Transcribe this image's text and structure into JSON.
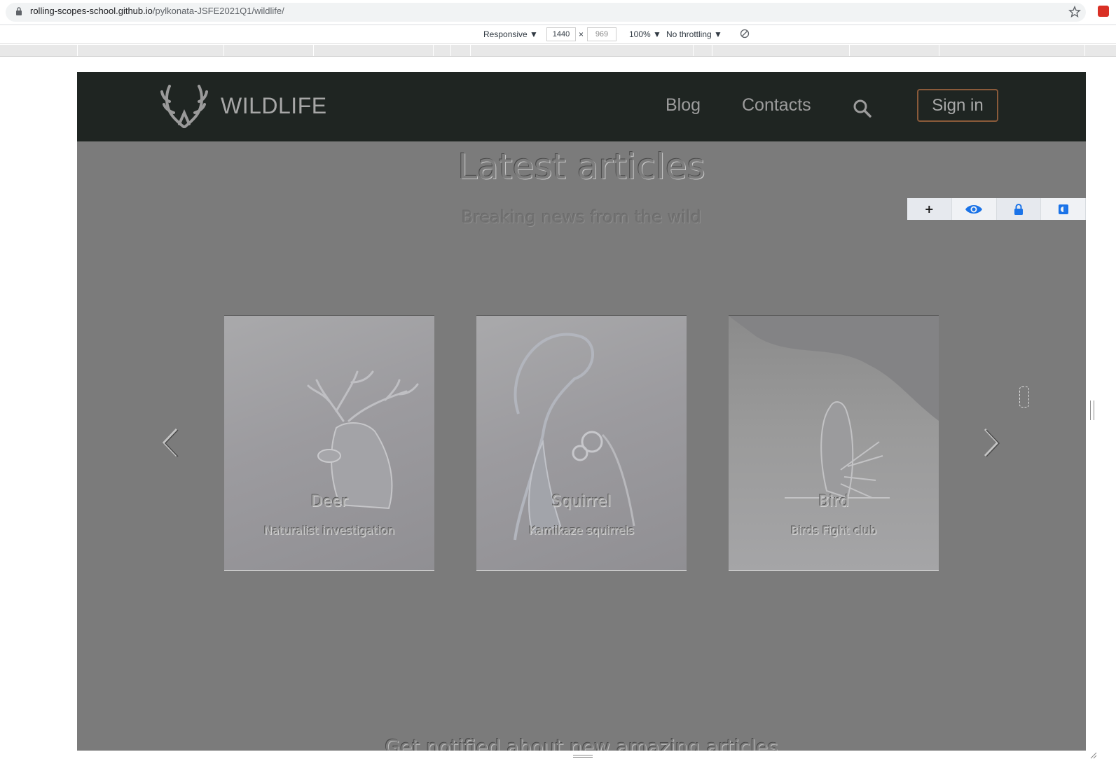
{
  "browser": {
    "url_host": "rolling-scopes-school.github.io",
    "url_path": "/pylkonata-JSFE2021Q1/wildlife/"
  },
  "device_toolbar": {
    "device": "Responsive ▼",
    "width": "1440",
    "times": "×",
    "height": "969",
    "zoom": "100% ▼",
    "throttling": "No throttling ▼"
  },
  "site": {
    "logo_text": "WILDLIFE",
    "nav": [
      "Blog",
      "Contacts"
    ],
    "signin_label": "Sign in"
  },
  "section": {
    "title": "Latest articles",
    "subtitle": "Breaking news from the wild"
  },
  "a11y_toolbar": {
    "icons": [
      "plus-icon",
      "eye-icon",
      "lock-icon",
      "contrast-icon"
    ],
    "accent": "#1a73e8"
  },
  "cards": [
    {
      "title": "Deer",
      "text": "Naturalist investigation"
    },
    {
      "title": "Squirrel",
      "text": "Kamikaze squirrels"
    },
    {
      "title": "Bird",
      "text": "Birds Fight club"
    }
  ],
  "next_section": {
    "title": "Get notified about new amazing articles"
  },
  "colors": {
    "header_bg": "#1f2522",
    "page_bg": "#7b7b7b",
    "signin_border": "#8a5a3a"
  }
}
